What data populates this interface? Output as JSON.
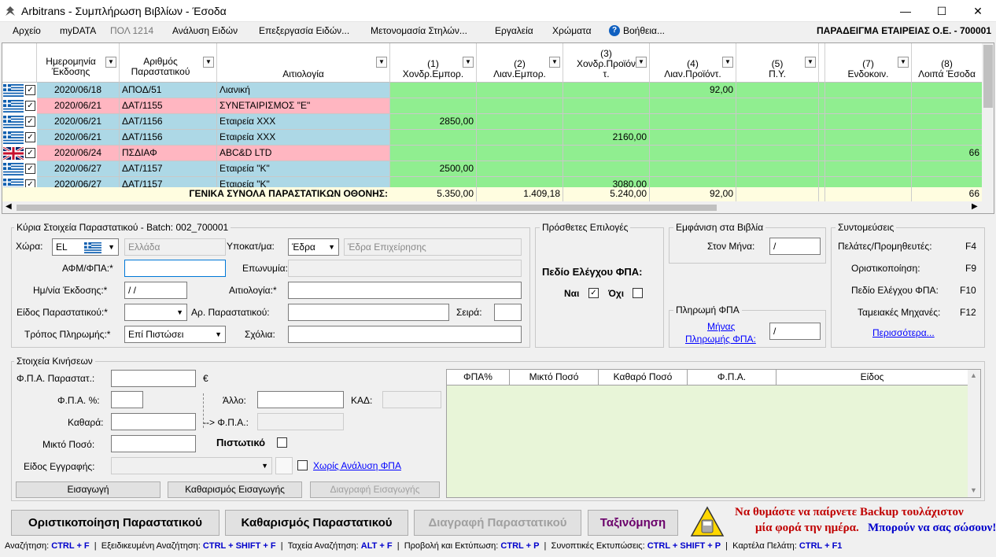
{
  "window": {
    "title": "Arbitrans - Συμπλήρωση Βιβλίων - Έσοδα",
    "minimize": "—",
    "maximize": "☐",
    "close": "✕"
  },
  "menu": {
    "items": [
      "Αρχείο",
      "myDATA",
      "ΠΟΛ 1214",
      "Ανάλυση Ειδών",
      "Επεξεργασία Ειδών...",
      "Μετονομασία Στηλών...",
      "Εργαλεία",
      "Χρώματα",
      "Βοήθεια..."
    ],
    "company": "ΠΑΡΑΔΕΙΓΜΑ ΕΤΑΙΡΕΙΑΣ Ο.Ε. - 700001"
  },
  "grid": {
    "headers": {
      "date": "Ημερομηνία Έκδοσης",
      "docno": "Αριθμός Παραστατικού",
      "reason": "Αιτιολογία",
      "c1a": "(1)",
      "c1b": "Χονδρ.Εμπορ.",
      "c2a": "(2)",
      "c2b": "Λιαν.Εμπορ.",
      "c3a": "(3)",
      "c3b": "Χονδρ.Προϊόν",
      "c3c": "τ.",
      "c4a": "(4)",
      "c4b": "Λιαν.Προϊόντ.",
      "c5a": "(5)",
      "c5b": "Π.Υ.",
      "c7a": "(7)",
      "c7b": "Ενδοκοιν.",
      "c8a": "(8)",
      "c8b": "Λοιπά Έσοδα"
    },
    "rows": [
      {
        "flag": "GR",
        "date": "2020/06/18",
        "docno": "ΑΠΟΔ/51",
        "reason": "Λιανική",
        "c1": "",
        "c2": "",
        "c3": "",
        "c4": "92,00",
        "c8": "",
        "color": "blue"
      },
      {
        "flag": "GR",
        "date": "2020/06/21",
        "docno": "ΔΑΤ/1155",
        "reason": "ΣΥΝΕΤΑΙΡΙΣΜΟΣ \"Ε\"",
        "c1": "",
        "c2": "",
        "c3": "",
        "c4": "",
        "c8": "",
        "color": "pink"
      },
      {
        "flag": "GR",
        "date": "2020/06/21",
        "docno": "ΔΑΤ/1156",
        "reason": "Εταιρεία ΧΧΧ",
        "c1": "2850,00",
        "c2": "",
        "c3": "",
        "c4": "",
        "c8": "",
        "color": "blue"
      },
      {
        "flag": "GR",
        "date": "2020/06/21",
        "docno": "ΔΑΤ/1156",
        "reason": "Εταιρεία ΧΧΧ",
        "c1": "",
        "c2": "",
        "c3": "2160,00",
        "c4": "",
        "c8": "",
        "color": "blue"
      },
      {
        "flag": "UK",
        "date": "2020/06/24",
        "docno": "ΠΣΔΙΑΦ",
        "reason": "ABC&D LTD",
        "c1": "",
        "c2": "",
        "c3": "",
        "c4": "",
        "c8": "66",
        "color": "pink"
      },
      {
        "flag": "GR",
        "date": "2020/06/27",
        "docno": "ΔΑΤ/1157",
        "reason": "Εταιρεία \"Κ\"",
        "c1": "2500,00",
        "c2": "",
        "c3": "",
        "c4": "",
        "c8": "",
        "color": "blue"
      },
      {
        "flag": "GR",
        "date": "2020/06/27",
        "docno": "ΔΑΤ/1157",
        "reason": "Εταιρεία \"Κ\"",
        "c1": "",
        "c2": "",
        "c3": "3080,00",
        "c4": "",
        "c8": "",
        "color": "blue"
      }
    ],
    "totals": {
      "label": "ΓΕΝΙΚΑ ΣΥΝΟΛΑ ΠΑΡΑΣΤΑΤΙΚΩΝ ΟΘΟΝΗΣ:",
      "c1": "5.350,00",
      "c2": "1.409,18",
      "c3": "5.240,00",
      "c4": "92,00",
      "c8": "66"
    }
  },
  "main": {
    "title": "Κύρια Στοιχεία Παραστατικού - Batch: 002_700001",
    "country_label": "Χώρα:",
    "country_value": "EL",
    "country_name": "Ελλάδα",
    "branch_label": "Υποκατ/μα:",
    "branch_value": "Έδρα",
    "branch_name": "Έδρα Επιχείρησης",
    "afm_label": "ΑΦΜ/ΦΠΑ:*",
    "name_label": "Επωνυμία:",
    "date_label": "Ημ/νία Έκδοσης:*",
    "date_value": " / /",
    "reason_label": "Αιτιολογία:*",
    "doctype_label": "Είδος Παραστατικού:*",
    "docno_label": "Αρ. Παραστατικού:",
    "series_label": "Σειρά:",
    "payment_label": "Τρόπος Πληρωμής:*",
    "payment_value": "Επί Πιστώσει",
    "comments_label": "Σχόλια:"
  },
  "extra": {
    "title": "Πρόσθετες Επιλογές",
    "vat_check": "Πεδίο Ελέγχου ΦΠΑ:",
    "yes": "Ναι",
    "no": "Όχι"
  },
  "books": {
    "title": "Εμφάνιση στα Βιβλία",
    "month_label": "Στον Μήνα:",
    "month_value": "/",
    "vatpay_title": "Πληρωμή ΦΠΑ",
    "vatpay_link1": "Μήνας",
    "vatpay_link2": "Πληρωμής ΦΠΑ:",
    "vatpay_value": "/"
  },
  "shortcuts": {
    "title": "Συντομεύσεις",
    "items": [
      {
        "label": "Πελάτες/Προμηθευτές:",
        "key": "F4"
      },
      {
        "label": "Οριστικοποίηση:",
        "key": "F9"
      },
      {
        "label": "Πεδίο Ελέγχου ΦΠΑ:",
        "key": "F10"
      },
      {
        "label": "Ταμειακές Μηχανές:",
        "key": "F12"
      }
    ],
    "more": "Περισσότερα..."
  },
  "moves": {
    "title": "Στοιχεία Κινήσεων",
    "vat_doc_label": "Φ.Π.Α. Παραστατ.:",
    "euro": "€",
    "vat_pct_label": "Φ.Π.Α. %:",
    "other_label": "Άλλο:",
    "kad_label": "ΚΑΔ:",
    "net_label": "Καθαρά:",
    "arrow_vat": "--> Φ.Π.Α.:",
    "gross_label": "Μικτό Ποσό:",
    "credit_label": "Πιστωτικό",
    "entry_type_label": "Είδος Εγγραφής:",
    "no_vat_link": "Χωρίς Ανάλυση ΦΠΑ",
    "btn_insert": "Εισαγωγή",
    "btn_clear_insert": "Καθαρισμός Εισαγωγής",
    "btn_delete_insert": "Διαγραφή Εισαγωγής",
    "table_headers": [
      "ΦΠΑ%",
      "Μικτό Ποσό",
      "Καθαρό Ποσό",
      "Φ.Π.Α.",
      "Είδος"
    ]
  },
  "actions": {
    "finalize": "Οριστικοποίηση Παραστατικού",
    "clear": "Καθαρισμός Παραστατικού",
    "delete": "Διαγραφή Παραστατικού",
    "sort": "Ταξινόμηση"
  },
  "backup": {
    "line1": "Να θυμάστε να παίρνετε Backup τουλάχιστον",
    "line2a": "μία φορά την ημέρα.",
    "line2b": "Μπορούν να σας σώσουν!"
  },
  "status": [
    {
      "label": "Αναζήτηση:",
      "key": "CTRL + F"
    },
    {
      "label": "Εξειδικευμένη Αναζήτηση:",
      "key": "CTRL + SHIFT + F"
    },
    {
      "label": "Ταχεία Αναζήτηση:",
      "key": "ALT + F"
    },
    {
      "label": "Προβολή και Εκτύπωση:",
      "key": "CTRL + P"
    },
    {
      "label": "Συνοπτικές Εκτυπώσεις:",
      "key": "CTRL + SHIFT + P"
    },
    {
      "label": "Καρτέλα Πελάτη:",
      "key": "CTRL + F1"
    }
  ],
  "colors": {
    "row_blue": "#add8e6",
    "row_pink": "#ffb6c1",
    "amount_green": "#90ee90",
    "totals": "#fffde0",
    "link": "#0000ff",
    "backup_red": "#c00000",
    "backup_blue": "#0000cc"
  }
}
